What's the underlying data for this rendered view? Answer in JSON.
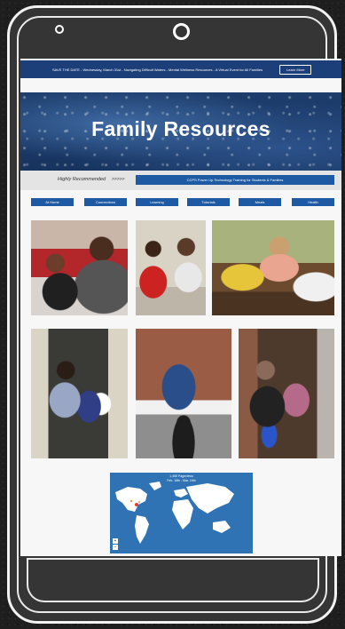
{
  "announcement": {
    "text": "SAVE THE DATE - Wednesday, March 31st - Navigating Difficult Waters - Mental Wellness Resources - A Virtual Event for All Families",
    "button_label": "Learn More"
  },
  "hero": {
    "title": "Family Resources"
  },
  "recommended": {
    "label": "Highly Recommended",
    "arrows": ">>>>>",
    "button_label": "CCPS Power Up Technology Training for Students & Families"
  },
  "nav": [
    {
      "label": "At Home"
    },
    {
      "label": "Connections"
    },
    {
      "label": "Learning"
    },
    {
      "label": "Tutorials"
    },
    {
      "label": "Meals"
    },
    {
      "label": "Health"
    }
  ],
  "map": {
    "title_line1": "1,455 Pageviews",
    "title_line2": "Feb. 16th - Mar. 16th",
    "zoom_in": "+",
    "zoom_out": "−"
  },
  "colors": {
    "announcement_bar": "#1c3f7a",
    "button_blue": "#1d5aa3",
    "map_water": "#2f73b5"
  }
}
